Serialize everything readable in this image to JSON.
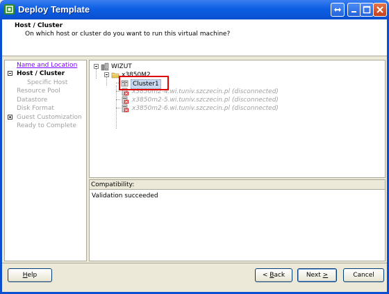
{
  "window": {
    "title": "Deploy Template",
    "colors": {
      "titlebar": "#0a4fd0",
      "highlight_box": "#e00000",
      "link": "#7b00ff"
    }
  },
  "header": {
    "title": "Host / Cluster",
    "subtitle": "On which host or cluster do you want to run this virtual machine?"
  },
  "steps": [
    {
      "label": "Name and Location",
      "state": "link"
    },
    {
      "label": "Host / Cluster",
      "state": "current"
    },
    {
      "label": "Specific Host",
      "state": "disabled"
    },
    {
      "label": "Resource Pool",
      "state": "disabled"
    },
    {
      "label": "Datastore",
      "state": "disabled"
    },
    {
      "label": "Disk Format",
      "state": "disabled"
    },
    {
      "label": "Guest Customization",
      "state": "disabled"
    },
    {
      "label": "Ready to Complete",
      "state": "disabled"
    }
  ],
  "tree": {
    "datacenter": {
      "label": "WIZUT",
      "icon": "datacenter-icon"
    },
    "folder": {
      "label": "x3850M2",
      "icon": "folder-icon"
    },
    "cluster": {
      "label": "Cluster1",
      "icon": "cluster-icon"
    },
    "hosts": [
      {
        "label": "x3850m2-4.wi.tuniv.szczecin.pl (disconnected)",
        "icon": "host-disconnected-icon"
      },
      {
        "label": "x3850m2-5.wi.tuniv.szczecin.pl (disconnected)",
        "icon": "host-disconnected-icon"
      },
      {
        "label": "x3850m2-6.wi.tuniv.szczecin.pl (disconnected)",
        "icon": "host-disconnected-icon"
      }
    ]
  },
  "compatibility": {
    "heading": "Compatibility:",
    "message": "Validation succeeded"
  },
  "buttons": {
    "help_pre": "",
    "help_u": "H",
    "help_post": "elp",
    "back_pre": "< ",
    "back_u": "B",
    "back_post": "ack",
    "next_pre": "Next ",
    "next_u": ">",
    "next_post": "",
    "cancel": "Cancel"
  }
}
